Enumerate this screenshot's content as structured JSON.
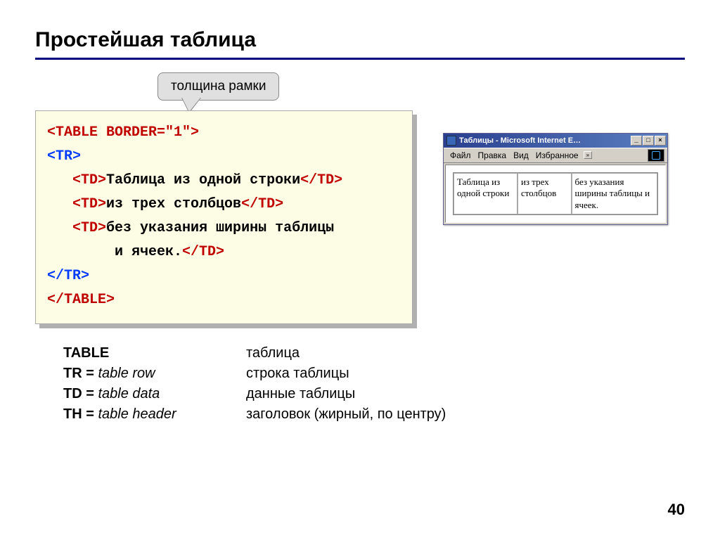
{
  "title": "Простейшая таблица",
  "callout": "толщина рамки",
  "code": {
    "line1_open": "<TABLE",
    "line1_attr": " BORDER=\"1\"",
    "line1_close": ">",
    "tr_open": "<TR>",
    "td_open": "<TD>",
    "td_close": "</TD>",
    "td1_text": "Таблица из одной строки",
    "td2_text": "из трех столбцов",
    "td3_text1": "без указания ширины таблицы",
    "td3_text2": "        и ячеек.",
    "tr_close": "</TR>",
    "table_close": "</TABLE>"
  },
  "ie": {
    "title": "Таблицы - Microsoft Internet E…",
    "menu": {
      "file": "Файл",
      "edit": "Правка",
      "view": "Вид",
      "fav": "Избранное",
      "chev": "»"
    },
    "min": "_",
    "max": "□",
    "close": "×",
    "cell1": "Таблица из одной строки",
    "cell2": "из трех столбцов",
    "cell3": "без указания ширины таблицы и ячеек."
  },
  "defs": {
    "r1t": "TABLE",
    "r1d": "таблица",
    "r2t": "TR = ",
    "r2i": "table row",
    "r2d": "строка таблицы",
    "r3t": "TD = ",
    "r3i": "table data",
    "r3d": "данные таблицы",
    "r4t": "TH = ",
    "r4i": "table header",
    "r4d": "заголовок (жирный, по центру)"
  },
  "pageNumber": "40"
}
